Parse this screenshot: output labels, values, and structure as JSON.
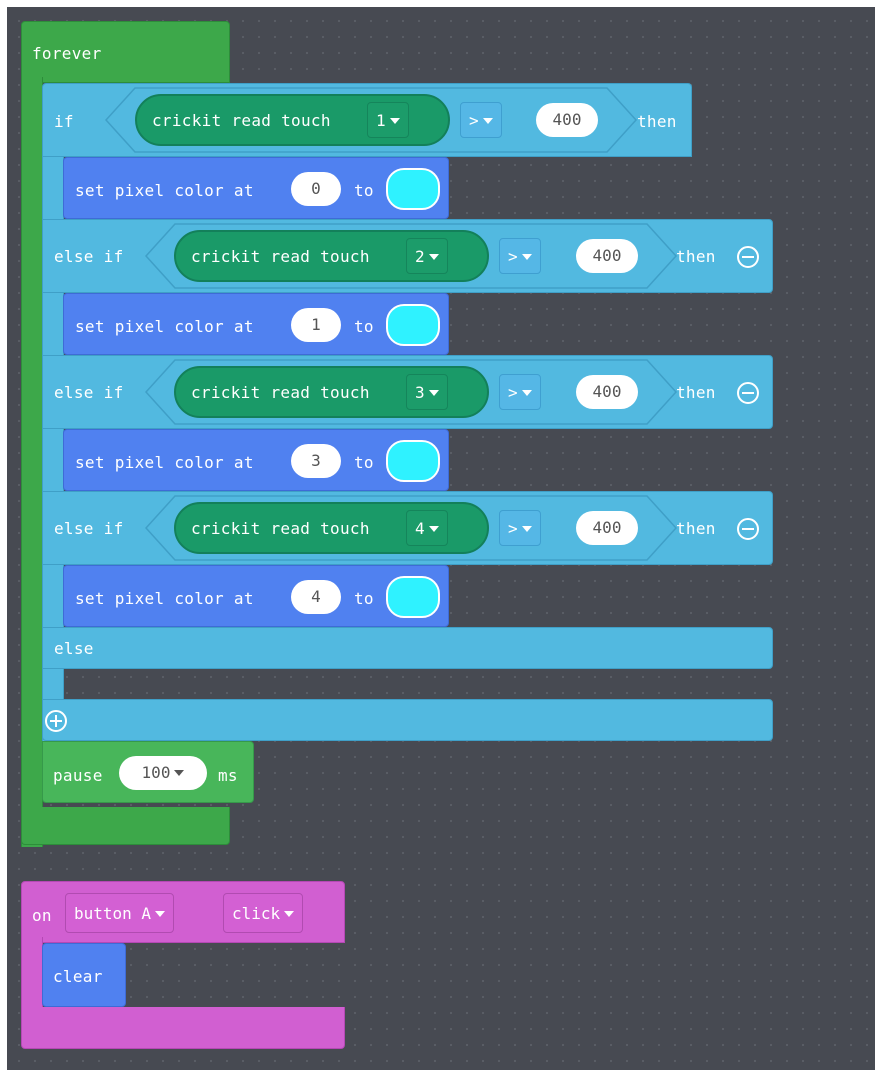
{
  "forever": {
    "label": "forever"
  },
  "if_block": {
    "if_label": "if",
    "else_if_label": "else if",
    "then_label": "then",
    "else_label": "else",
    "branches": [
      {
        "touch_label": "crickit read touch",
        "pin": "1",
        "op": ">",
        "value": "400"
      },
      {
        "touch_label": "crickit read touch",
        "pin": "2",
        "op": ">",
        "value": "400"
      },
      {
        "touch_label": "crickit read touch",
        "pin": "3",
        "op": ">",
        "value": "400"
      },
      {
        "touch_label": "crickit read touch",
        "pin": "4",
        "op": ">",
        "value": "400"
      }
    ],
    "set_pixels": [
      {
        "label": "set pixel color at",
        "index": "0",
        "to_label": "to",
        "color": "#2ff2ff"
      },
      {
        "label": "set pixel color at",
        "index": "1",
        "to_label": "to",
        "color": "#2ff2ff"
      },
      {
        "label": "set pixel color at",
        "index": "3",
        "to_label": "to",
        "color": "#2ff2ff"
      },
      {
        "label": "set pixel color at",
        "index": "4",
        "to_label": "to",
        "color": "#2ff2ff"
      }
    ]
  },
  "pause": {
    "label": "pause",
    "value": "100",
    "unit": "ms"
  },
  "on_button": {
    "on_label": "on",
    "button": "button A",
    "event": "click",
    "action": "clear"
  },
  "colors": {
    "workspace": "#474a52",
    "loops": "#3da84a",
    "logic": "#52b9e0",
    "light": "#5081f0",
    "input": "#d15fd1",
    "crickit": "#1a9a68"
  },
  "icons": [
    "remove-branch-icon",
    "add-branch-icon",
    "dropdown-caret-icon"
  ]
}
